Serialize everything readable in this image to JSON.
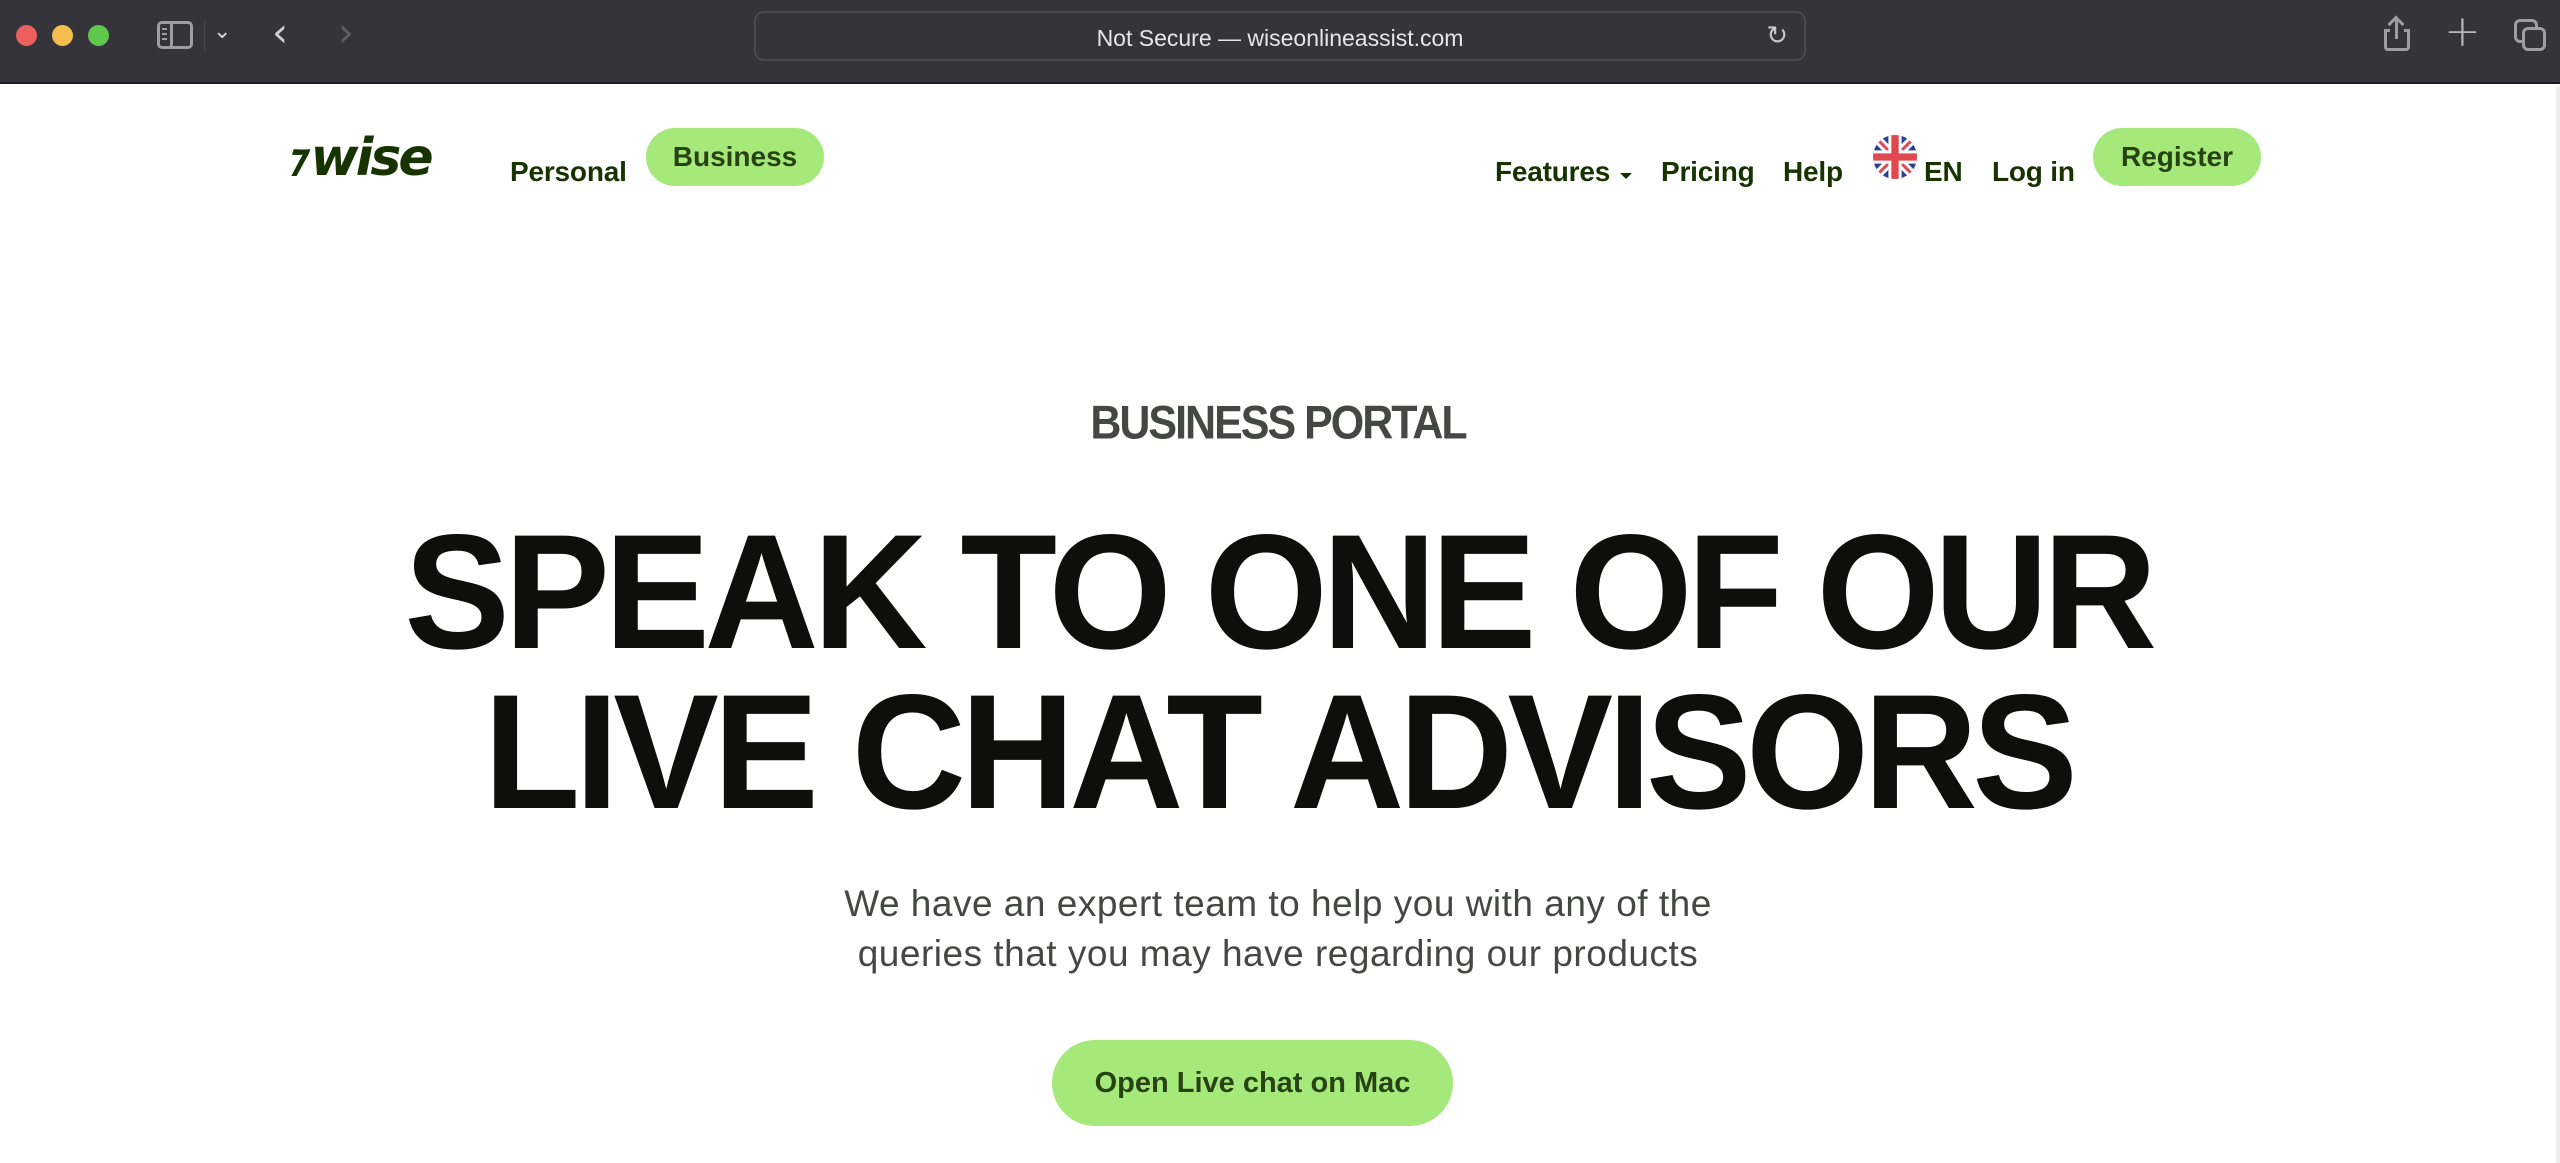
{
  "browser": {
    "url_text": "Not Secure — wiseonlineassist.com",
    "icons": {
      "close": "close-window-icon",
      "minimize": "minimize-window-icon",
      "zoom": "zoom-window-icon",
      "sidebar": "sidebar-icon",
      "dropdown": "chevron-down-icon",
      "back": "back-arrow-icon",
      "forward": "forward-arrow-icon",
      "reload": "reload-icon",
      "share": "share-icon",
      "new_tab": "plus-icon",
      "tabs": "tab-overview-icon"
    },
    "glyphs": {
      "chevron_down": "⌄",
      "back": "‹",
      "forward": "›",
      "reload": "↻",
      "plus": "+"
    }
  },
  "nav": {
    "logo_mark": "⁊",
    "logo_text": "wise",
    "personal": "Personal",
    "business": "Business",
    "features": "Features",
    "pricing": "Pricing",
    "help": "Help",
    "language": "EN",
    "login": "Log in",
    "register": "Register"
  },
  "hero": {
    "eyebrow": "BUSINESS PORTAL",
    "headline_line1": "SPEAK TO ONE OF OUR",
    "headline_line2": "LIVE CHAT ADVISORS",
    "subtitle_line1": "We have an expert team to help you with any of the",
    "subtitle_line2": "queries that you may have regarding our products",
    "cta": "Open Live chat on Mac"
  },
  "colors": {
    "brand_green": "#9fe870",
    "brand_dark": "#163300",
    "headline": "#0e0f0c",
    "body_text": "#454745",
    "chrome_bg": "#35343a"
  }
}
